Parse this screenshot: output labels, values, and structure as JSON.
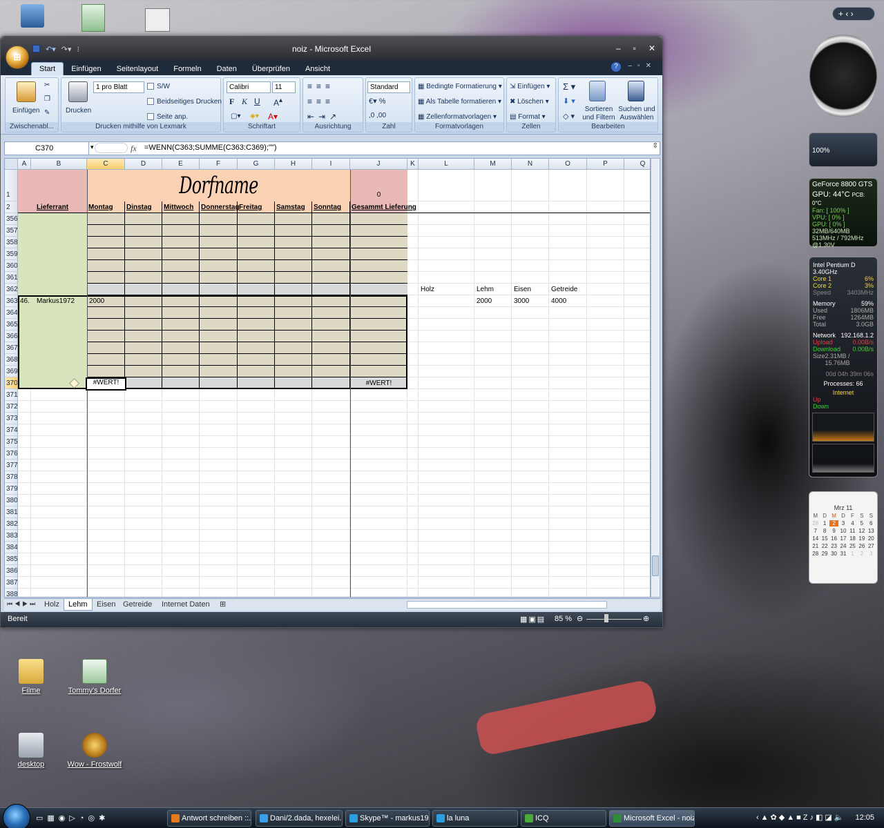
{
  "window": {
    "title": "noiz - Microsoft Excel"
  },
  "ribbon": {
    "tabs": [
      "Start",
      "Einfügen",
      "Seitenlayout",
      "Formeln",
      "Daten",
      "Überprüfen",
      "Ansicht"
    ],
    "clipboard": {
      "paste": "Einfügen",
      "label": "Zwischenabl..."
    },
    "print": {
      "print_btn": "Drucken",
      "pages_combo": "1 pro Blatt",
      "sw": "S/W",
      "duplex": "Beidseitiges Drucken",
      "fit": "Seite anp.",
      "label": "Drucken mithilfe von Lexmark"
    },
    "font": {
      "name": "Calibri",
      "size": "11",
      "label": "Schriftart"
    },
    "alignment": {
      "label": "Ausrichtung"
    },
    "number": {
      "format": "Standard",
      "label": "Zahl"
    },
    "styles": {
      "conditional": "Bedingte Formatierung",
      "as_table": "Als Tabelle formatieren",
      "cell_styles": "Zellenformatvorlagen",
      "label": "Formatvorlagen"
    },
    "cells": {
      "insert": "Einfügen",
      "delete": "Löschen",
      "format": "Format",
      "label": "Zellen"
    },
    "editing": {
      "sort": "Sortieren und Filtern",
      "find": "Suchen und Auswählen",
      "label": "Bearbeiten"
    }
  },
  "formula_bar": {
    "name_box": "C370",
    "fx": "fx",
    "formula": "=WENN(C363;SUMME(C363:C369);\"\")"
  },
  "sheet": {
    "columns": [
      "A",
      "B",
      "C",
      "D",
      "E",
      "F",
      "G",
      "H",
      "I",
      "J",
      "K",
      "L",
      "M",
      "N",
      "O",
      "P",
      "Q"
    ],
    "title": "Dorfname",
    "total_value": "0",
    "headers": {
      "lieferant": "Lieferrant",
      "days": [
        "Montag",
        "Dinstag",
        "Mittwoch",
        "Donnerstag",
        "Freitag",
        "Samstag",
        "Sonntag"
      ],
      "total": "Gesammt Lieferung"
    },
    "row_numbers": [
      "1",
      "2",
      "356",
      "357",
      "358",
      "359",
      "360",
      "361",
      "362",
      "363",
      "364",
      "365",
      "366",
      "367",
      "368",
      "369",
      "370",
      "371",
      "372",
      "373",
      "374",
      "375",
      "376",
      "377",
      "378",
      "379",
      "380",
      "381",
      "382",
      "383",
      "384",
      "385",
      "386",
      "387",
      "388"
    ],
    "entry": {
      "num": "46.",
      "name": "Markus1972",
      "monday": "2000"
    },
    "errors": {
      "c370": "#WERT!",
      "j370": "#WERT!"
    },
    "side_table": {
      "headers": [
        "Holz",
        "Lehm",
        "Eisen",
        "Getreide"
      ],
      "values": [
        "2000",
        "3000",
        "4000"
      ]
    }
  },
  "sheet_tabs": [
    "Holz",
    "Lehm",
    "Eisen",
    "Getreide",
    "Internet Daten"
  ],
  "active_sheet": "Lehm",
  "status": {
    "ready": "Bereit",
    "zoom": "85 %"
  },
  "desktop_icons": [
    "Filme",
    "Tommy's Dorfer",
    "desktop",
    "Wow - Frostwolf"
  ],
  "gadgets": {
    "volume": "100%",
    "gpu": {
      "name": "GeForce 8800 GTS",
      "temp": "GPU: 44°C",
      "pcb": "PCB: 0°C",
      "fan": "Fan: [ 100% ]",
      "vpu": "VPU: [ 0% ]",
      "gpu_load": "GPU: [ 0% ]",
      "mem": "32MB/640MB",
      "clocks": "513MHz / 792MHz @1.30V"
    },
    "cpu": {
      "name": "Intel Pentium D 3.40GHz",
      "core1": "Core 1",
      "core1_val": "6%",
      "core2": "Core 2",
      "core2_val": "3%",
      "speed": "Speed",
      "speed_val": "3403MHz",
      "memory": "Memory",
      "memory_val": "59%",
      "used": "Used",
      "used_val": "1806MB",
      "free": "Free",
      "free_val": "1264MB",
      "total": "Total",
      "total_val": "3.0GB",
      "network": "Network",
      "ip": "192.168.1.2",
      "upload": "Upload",
      "upload_val": "0.00B/s",
      "download": "Download",
      "download_val": "0.00B/s",
      "size": "Size",
      "size_val": "2.31MB / 15.76MB",
      "uptime": "00d 04h 39m 06s",
      "processes": "Processes: 66",
      "internet": "Internet",
      "up": "Up",
      "down": "Down"
    },
    "calendar": {
      "month": "Mrz 11",
      "days": [
        "M",
        "D",
        "M",
        "D",
        "F",
        "S",
        "S"
      ],
      "dates": [
        "28",
        "1",
        "2",
        "3",
        "4",
        "5",
        "6",
        "7",
        "8",
        "9",
        "10",
        "11",
        "12",
        "13",
        "14",
        "15",
        "16",
        "17",
        "18",
        "19",
        "20",
        "21",
        "22",
        "23",
        "24",
        "25",
        "26",
        "27",
        "28",
        "29",
        "30",
        "31",
        "1",
        "2",
        "3"
      ]
    }
  },
  "taskbar": {
    "items": [
      "Antwort schreiben ::....",
      "Dani/2.dada, hexelei...",
      "Skype™ - markus19...",
      "la luna",
      "ICQ",
      "Microsoft Excel - noiz"
    ],
    "clock": "12:05"
  },
  "colors": {
    "header_pink": "#e9b9b7",
    "title_orange": "#fbd3b4",
    "name_green": "#d7e4bd",
    "data_tan": "#ddd9c4",
    "total_grey": "#d9d9d9"
  }
}
